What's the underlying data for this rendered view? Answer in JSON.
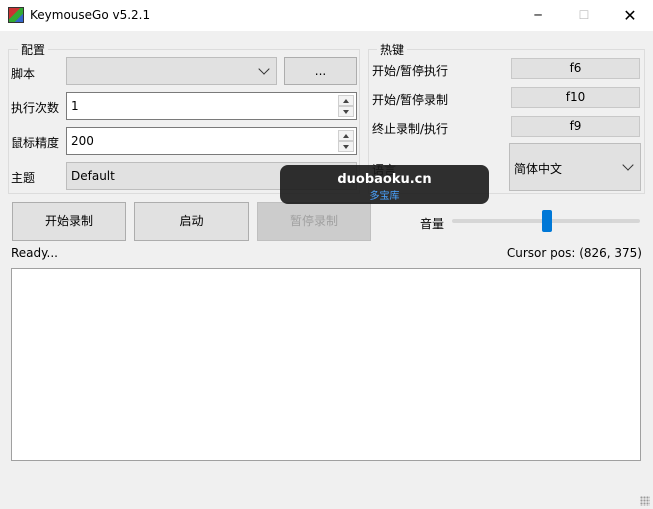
{
  "window": {
    "title": "KeymouseGo v5.2.1",
    "minimize": "─",
    "maximize": "☐",
    "close": "✕"
  },
  "config": {
    "group_title": "配置",
    "script_label": "脚本",
    "script_value": "",
    "browse_label": "...",
    "run_times_label": "执行次数",
    "run_times_value": "1",
    "mouse_precision_label": "鼠标精度",
    "mouse_precision_value": "200",
    "theme_label": "主题",
    "theme_value": "Default"
  },
  "hotkeys": {
    "group_title": "热键",
    "items": [
      {
        "label": "开始/暂停执行",
        "key": "f6"
      },
      {
        "label": "开始/暂停录制",
        "key": "f10"
      },
      {
        "label": "终止录制/执行",
        "key": "f9"
      }
    ],
    "language_label": "语言",
    "language_value": "简体中文"
  },
  "actions": {
    "record": "开始录制",
    "launch": "启动",
    "pause_record": "暂停录制"
  },
  "volume": {
    "label": "音量",
    "level": 0.5
  },
  "status": {
    "text": "Ready...",
    "cursor_pos": "Cursor pos: (826, 375)"
  },
  "watermark": {
    "main": "duobaoku.cn",
    "sub": "多宝库"
  },
  "colors": {
    "accent": "#0078d7"
  }
}
